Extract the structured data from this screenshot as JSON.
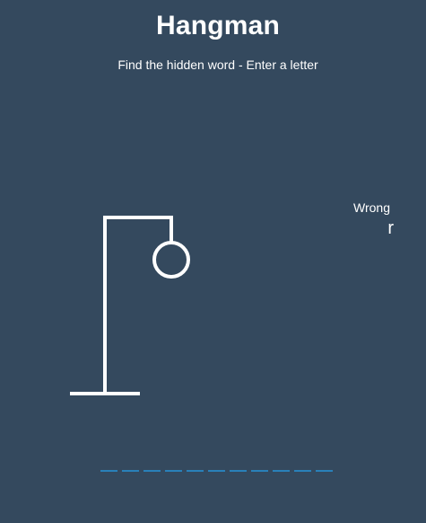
{
  "header": {
    "title": "Hangman",
    "subtitle": "Find the hidden word - Enter a letter"
  },
  "wrong": {
    "label": "Wrong",
    "letters": "r"
  },
  "word": {
    "letters": [
      "",
      "",
      "",
      "",
      "",
      "",
      "",
      "",
      "",
      "",
      ""
    ]
  },
  "colors": {
    "background": "#34495e",
    "text": "#ffffff",
    "blank_underline": "#2980b9",
    "figure_stroke": "#ffffff"
  },
  "figure": {
    "wrong_count": 1,
    "parts_shown": [
      "gallows",
      "head"
    ]
  }
}
